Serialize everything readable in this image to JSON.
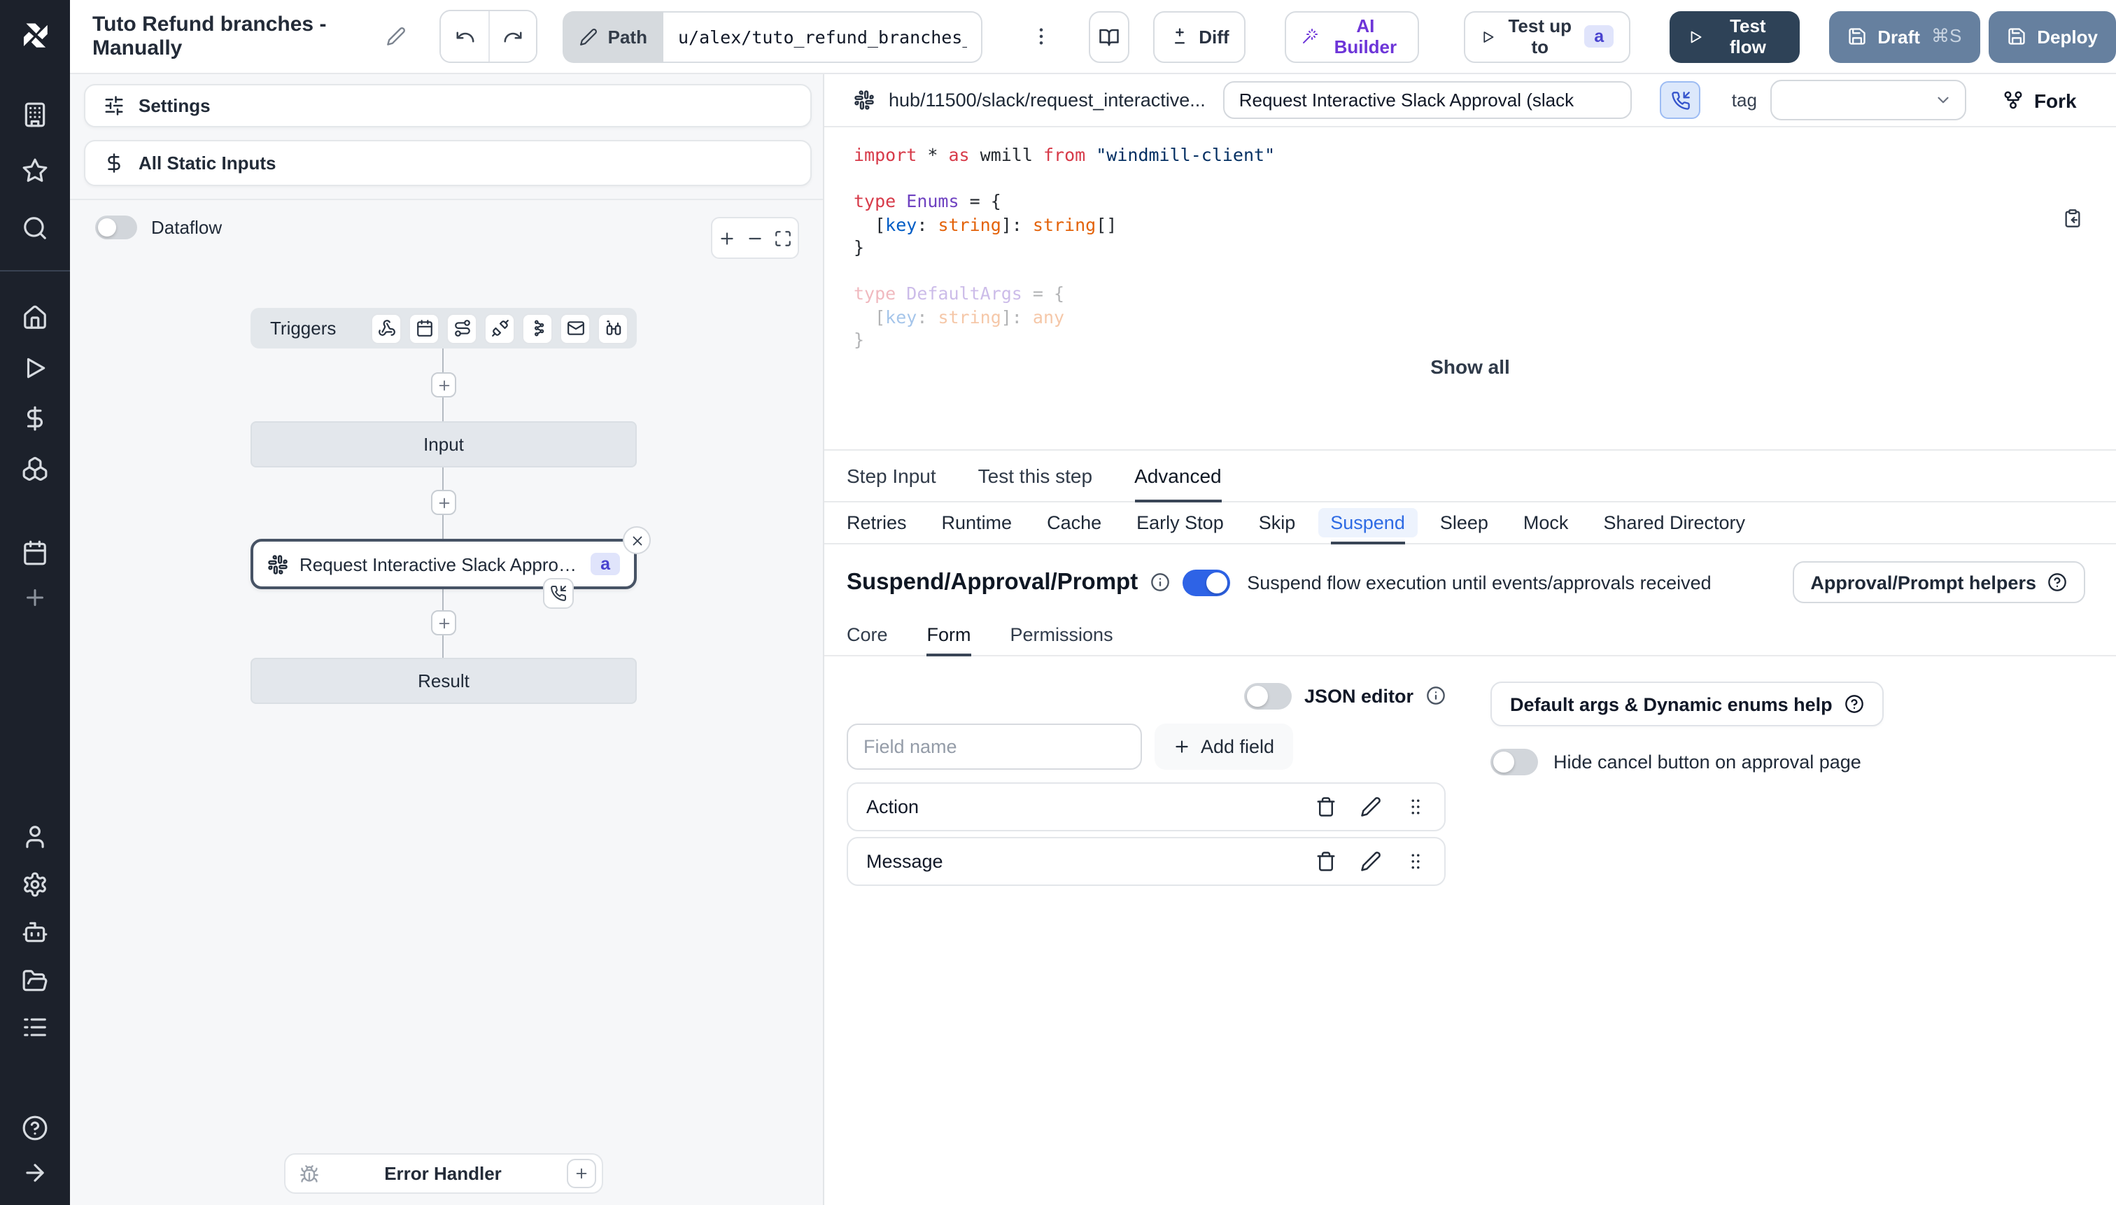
{
  "topbar": {
    "title": "Tuto Refund branches - Manually",
    "path_label": "Path",
    "path_value": "u/alex/tuto_refund_branches__",
    "diff": "Diff",
    "ai_builder": "AI Builder",
    "test_up_to": "Test up to",
    "test_up_to_badge": "a",
    "test_flow": "Test flow",
    "draft": "Draft",
    "draft_shortcut": "⌘S",
    "deploy": "Deploy"
  },
  "flow_panel": {
    "settings": "Settings",
    "all_static_inputs": "All Static Inputs",
    "dataflow": "Dataflow",
    "triggers_label": "Triggers",
    "input_node": "Input",
    "step_node": {
      "label": "Request Interactive Slack Approval (...",
      "badge": "a"
    },
    "result_node": "Result",
    "error_handler": "Error Handler"
  },
  "step_panel": {
    "hub_path": "hub/11500/slack/request_interactive...",
    "summary_value": "Request Interactive Slack Approval (slack",
    "tag_label": "tag",
    "fork": "Fork",
    "show_all": "Show all",
    "tabs": [
      "Step Input",
      "Test this step",
      "Advanced"
    ],
    "active_tab": "Advanced",
    "subtabs": [
      "Retries",
      "Runtime",
      "Cache",
      "Early Stop",
      "Skip",
      "Suspend",
      "Sleep",
      "Mock",
      "Shared Directory"
    ],
    "active_subtab": "Suspend",
    "code": {
      "lines": [
        {
          "tokens": [
            [
              "kw",
              "import"
            ],
            [
              "pl",
              " * "
            ],
            [
              "kw",
              "as"
            ],
            [
              "pl",
              " wmill "
            ],
            [
              "kw",
              "from"
            ],
            [
              "pl",
              " "
            ],
            [
              "str",
              "\"windmill-client\""
            ]
          ]
        },
        {
          "tokens": []
        },
        {
          "tokens": [
            [
              "kw",
              "type"
            ],
            [
              "pl",
              " "
            ],
            [
              "ty",
              "Enums"
            ],
            [
              "pl",
              " = {"
            ]
          ]
        },
        {
          "tokens": [
            [
              "pl",
              "  ["
            ],
            [
              "pr",
              "key"
            ],
            [
              "pl",
              ": "
            ],
            [
              "or",
              "string"
            ],
            [
              "pl",
              "]: "
            ],
            [
              "or",
              "string"
            ],
            [
              "pl",
              "[]"
            ]
          ]
        },
        {
          "tokens": [
            [
              "pl",
              "}"
            ]
          ]
        },
        {
          "tokens": []
        },
        {
          "tokens": [
            [
              "kw",
              "type"
            ],
            [
              "pl",
              " "
            ],
            [
              "ty",
              "DefaultArgs"
            ],
            [
              "pl",
              " = {"
            ]
          ],
          "faded": true
        },
        {
          "tokens": [
            [
              "pl",
              "  ["
            ],
            [
              "pr",
              "key"
            ],
            [
              "pl",
              ": "
            ],
            [
              "or",
              "string"
            ],
            [
              "pl",
              "]: "
            ],
            [
              "or",
              "any"
            ]
          ],
          "faded": true
        },
        {
          "tokens": [
            [
              "pl",
              "}"
            ]
          ],
          "faded": true
        }
      ]
    },
    "suspend": {
      "heading": "Suspend/Approval/Prompt",
      "toggle_description": "Suspend flow execution until events/approvals received",
      "helpers_button": "Approval/Prompt helpers",
      "tabs": [
        "Core",
        "Form",
        "Permissions"
      ],
      "active_tab": "Form",
      "json_editor": "JSON editor",
      "field_placeholder": "Field name",
      "add_field": "Add field",
      "fields": [
        "Action",
        "Message"
      ],
      "default_args_button": "Default args & Dynamic enums help",
      "hide_cancel": "Hide cancel button on approval page"
    }
  },
  "colors": {
    "accent_blue": "#2e63e6",
    "dark_button": "#2e4257",
    "slate_button": "#66809f",
    "sidebar_bg": "#1c212b",
    "ai_purple": "#6d35d8"
  }
}
